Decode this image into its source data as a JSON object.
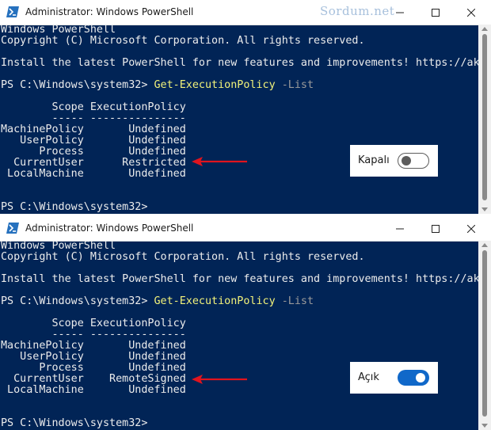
{
  "watermark": "Sordum.net",
  "windows": [
    {
      "title": "Administrator: Windows PowerShell",
      "console": {
        "line1": "Windows PowerShell",
        "line2": "Copyright (C) Microsoft Corporation. All rights reserved.",
        "line3": "Install the latest PowerShell for new features and improvements! https://ak",
        "prompt": "PS C:\\Windows\\system32>",
        "command": "Get-ExecutionPolicy",
        "parameter": "-List",
        "table_header": "        Scope ExecutionPolicy",
        "table_sep": "        ----- ---------------",
        "rows": [
          "MachinePolicy       Undefined",
          "   UserPolicy       Undefined",
          "      Process       Undefined",
          "  CurrentUser      Restricted",
          " LocalMachine       Undefined"
        ],
        "final_prompt": "PS C:\\Windows\\system32>"
      },
      "toggle": {
        "label": "Kapalı",
        "state": "off"
      }
    },
    {
      "title": "Administrator: Windows PowerShell",
      "console": {
        "line1": "Windows PowerShell",
        "line2": "Copyright (C) Microsoft Corporation. All rights reserved.",
        "line3": "Install the latest PowerShell for new features and improvements! https://ak",
        "prompt": "PS C:\\Windows\\system32>",
        "command": "Get-ExecutionPolicy",
        "parameter": "-List",
        "table_header": "        Scope ExecutionPolicy",
        "table_sep": "        ----- ---------------",
        "rows": [
          "MachinePolicy       Undefined",
          "   UserPolicy       Undefined",
          "      Process       Undefined",
          "  CurrentUser    RemoteSigned",
          " LocalMachine       Undefined"
        ],
        "final_prompt": "PS C:\\Windows\\system32>"
      },
      "toggle": {
        "label": "Açık",
        "state": "on"
      }
    }
  ],
  "colors": {
    "console_bg": "#012456",
    "console_text": "#ececec",
    "command": "#f2f27a",
    "parameter": "#9a9a9a",
    "arrow": "#e0141e",
    "toggle_on": "#1068c9"
  },
  "icons": [
    "powershell-icon",
    "minimize-icon",
    "maximize-icon",
    "close-icon",
    "red-arrow-icon"
  ]
}
